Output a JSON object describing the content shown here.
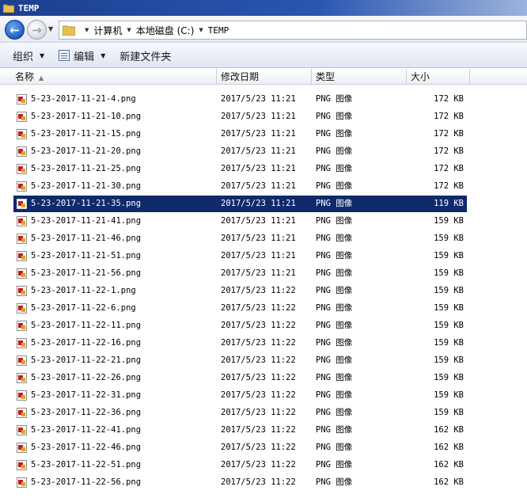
{
  "window": {
    "title": "TEMP"
  },
  "address": {
    "crumbs": [
      "计算机",
      "本地磁盘 (C:)",
      "TEMP"
    ]
  },
  "toolbar": {
    "organize_label": "组织",
    "edit_label": "编辑",
    "new_folder_label": "新建文件夹"
  },
  "columns": {
    "name": "名称",
    "date": "修改日期",
    "type": "类型",
    "size": "大小"
  },
  "files": [
    {
      "name": "5-23-2017-11-21-4.png",
      "date": "2017/5/23 11:21",
      "type": "PNG 图像",
      "size": "172 KB"
    },
    {
      "name": "5-23-2017-11-21-10.png",
      "date": "2017/5/23 11:21",
      "type": "PNG 图像",
      "size": "172 KB"
    },
    {
      "name": "5-23-2017-11-21-15.png",
      "date": "2017/5/23 11:21",
      "type": "PNG 图像",
      "size": "172 KB"
    },
    {
      "name": "5-23-2017-11-21-20.png",
      "date": "2017/5/23 11:21",
      "type": "PNG 图像",
      "size": "172 KB"
    },
    {
      "name": "5-23-2017-11-21-25.png",
      "date": "2017/5/23 11:21",
      "type": "PNG 图像",
      "size": "172 KB"
    },
    {
      "name": "5-23-2017-11-21-30.png",
      "date": "2017/5/23 11:21",
      "type": "PNG 图像",
      "size": "172 KB"
    },
    {
      "name": "5-23-2017-11-21-35.png",
      "date": "2017/5/23 11:21",
      "type": "PNG 图像",
      "size": "119 KB",
      "selected": true
    },
    {
      "name": "5-23-2017-11-21-41.png",
      "date": "2017/5/23 11:21",
      "type": "PNG 图像",
      "size": "159 KB"
    },
    {
      "name": "5-23-2017-11-21-46.png",
      "date": "2017/5/23 11:21",
      "type": "PNG 图像",
      "size": "159 KB"
    },
    {
      "name": "5-23-2017-11-21-51.png",
      "date": "2017/5/23 11:21",
      "type": "PNG 图像",
      "size": "159 KB"
    },
    {
      "name": "5-23-2017-11-21-56.png",
      "date": "2017/5/23 11:21",
      "type": "PNG 图像",
      "size": "159 KB"
    },
    {
      "name": "5-23-2017-11-22-1.png",
      "date": "2017/5/23 11:22",
      "type": "PNG 图像",
      "size": "159 KB"
    },
    {
      "name": "5-23-2017-11-22-6.png",
      "date": "2017/5/23 11:22",
      "type": "PNG 图像",
      "size": "159 KB"
    },
    {
      "name": "5-23-2017-11-22-11.png",
      "date": "2017/5/23 11:22",
      "type": "PNG 图像",
      "size": "159 KB"
    },
    {
      "name": "5-23-2017-11-22-16.png",
      "date": "2017/5/23 11:22",
      "type": "PNG 图像",
      "size": "159 KB"
    },
    {
      "name": "5-23-2017-11-22-21.png",
      "date": "2017/5/23 11:22",
      "type": "PNG 图像",
      "size": "159 KB"
    },
    {
      "name": "5-23-2017-11-22-26.png",
      "date": "2017/5/23 11:22",
      "type": "PNG 图像",
      "size": "159 KB"
    },
    {
      "name": "5-23-2017-11-22-31.png",
      "date": "2017/5/23 11:22",
      "type": "PNG 图像",
      "size": "159 KB"
    },
    {
      "name": "5-23-2017-11-22-36.png",
      "date": "2017/5/23 11:22",
      "type": "PNG 图像",
      "size": "159 KB"
    },
    {
      "name": "5-23-2017-11-22-41.png",
      "date": "2017/5/23 11:22",
      "type": "PNG 图像",
      "size": "162 KB"
    },
    {
      "name": "5-23-2017-11-22-46.png",
      "date": "2017/5/23 11:22",
      "type": "PNG 图像",
      "size": "162 KB"
    },
    {
      "name": "5-23-2017-11-22-51.png",
      "date": "2017/5/23 11:22",
      "type": "PNG 图像",
      "size": "162 KB"
    },
    {
      "name": "5-23-2017-11-22-56.png",
      "date": "2017/5/23 11:22",
      "type": "PNG 图像",
      "size": "162 KB"
    }
  ],
  "colors": {
    "selection": "#0f2a6b",
    "titlebar": "#1c3f8f"
  }
}
